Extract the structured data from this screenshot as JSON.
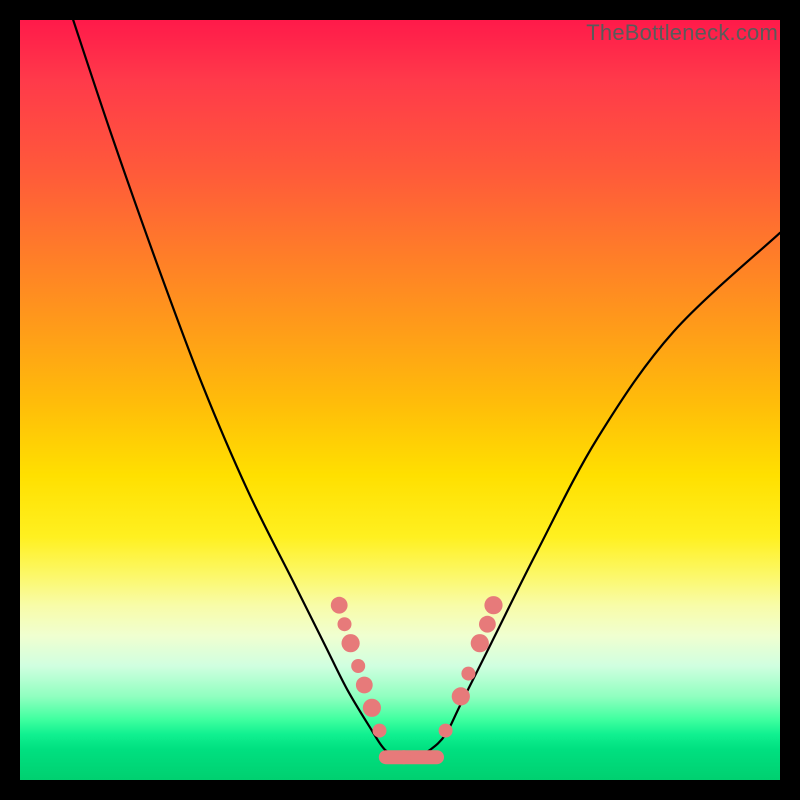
{
  "watermark": "TheBottleneck.com",
  "chart_data": {
    "type": "line",
    "title": "",
    "xlabel": "",
    "ylabel": "",
    "xlim": [
      0,
      100
    ],
    "ylim": [
      0,
      100
    ],
    "series": [
      {
        "name": "bottleneck-curve",
        "x": [
          7,
          12,
          18,
          24,
          30,
          36,
          40,
          43,
          46,
          48,
          50,
          52,
          54,
          56,
          58,
          62,
          68,
          76,
          86,
          100
        ],
        "y": [
          100,
          85,
          68,
          52,
          38,
          26,
          18,
          12,
          7,
          4,
          3,
          3,
          4,
          6,
          10,
          18,
          30,
          45,
          59,
          72
        ]
      }
    ],
    "markers": {
      "name": "highlight-points",
      "color": "#e77a7a",
      "points": [
        {
          "x": 42.0,
          "y": 23.0,
          "r": 1.2
        },
        {
          "x": 42.7,
          "y": 20.5,
          "r": 1.0
        },
        {
          "x": 43.5,
          "y": 18.0,
          "r": 1.3
        },
        {
          "x": 44.5,
          "y": 15.0,
          "r": 1.0
        },
        {
          "x": 45.3,
          "y": 12.5,
          "r": 1.2
        },
        {
          "x": 46.3,
          "y": 9.5,
          "r": 1.3
        },
        {
          "x": 47.3,
          "y": 6.5,
          "r": 1.0
        },
        {
          "x": 50.5,
          "y": 3.0,
          "r": 1.0
        },
        {
          "x": 56.0,
          "y": 6.5,
          "r": 1.0
        },
        {
          "x": 58.0,
          "y": 11.0,
          "r": 1.3
        },
        {
          "x": 59.0,
          "y": 14.0,
          "r": 1.0
        },
        {
          "x": 60.5,
          "y": 18.0,
          "r": 1.3
        },
        {
          "x": 61.5,
          "y": 20.5,
          "r": 1.2
        },
        {
          "x": 62.3,
          "y": 23.0,
          "r": 1.3
        }
      ],
      "bottom_bar": {
        "x1": 48.0,
        "x2": 55.0,
        "y": 3.0
      }
    }
  }
}
